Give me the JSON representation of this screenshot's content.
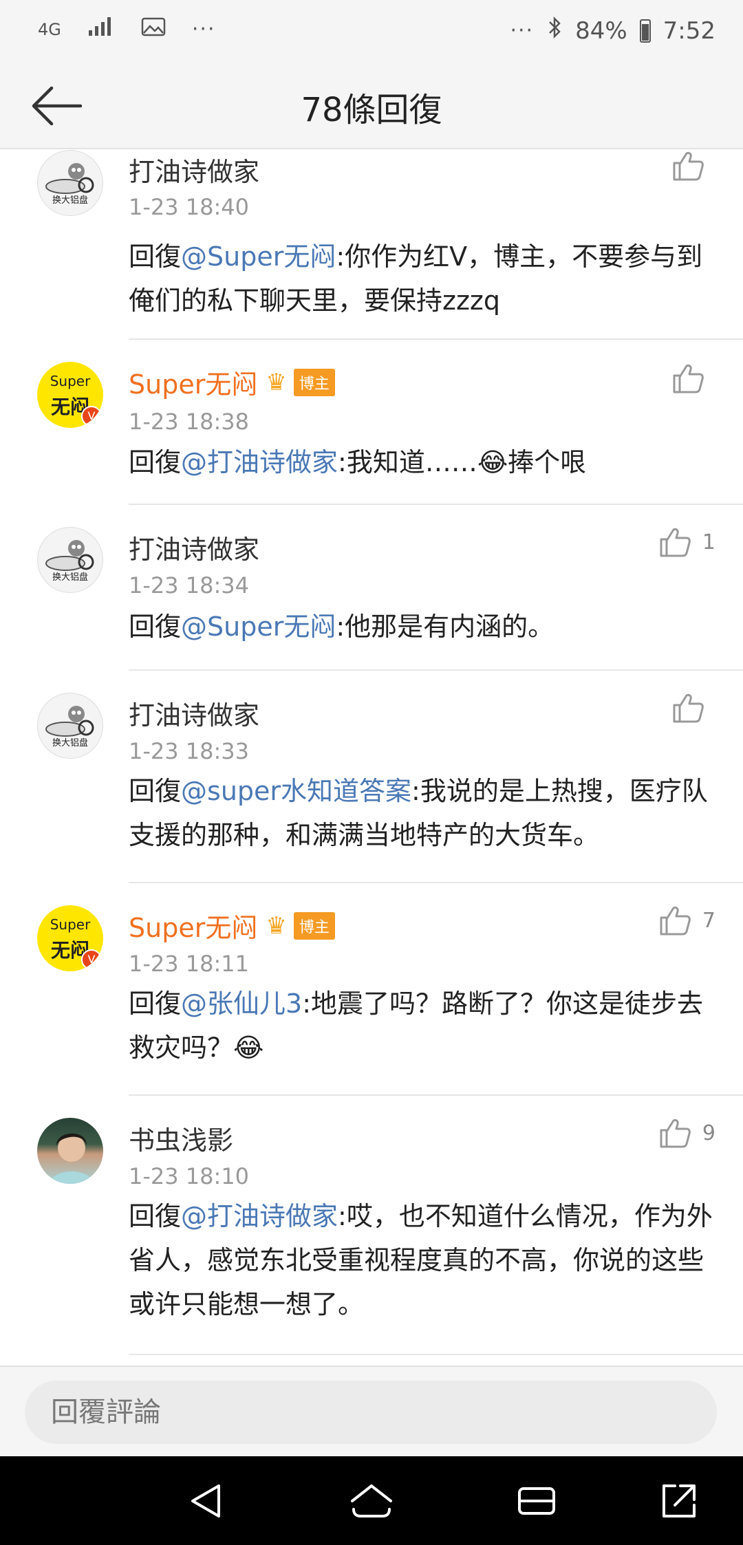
{
  "status_bar": {
    "network": "4G",
    "dots_left": "···",
    "dots_right": "···",
    "battery": "84%",
    "battery_level": 0.84,
    "time": "7:52"
  },
  "header": {
    "title": "78條回復"
  },
  "comments": [
    {
      "user": "打油诗做家",
      "avatar_text": "换大铝盘",
      "verified": false,
      "is_author": false,
      "time": "1-23 18:40",
      "reply_prefix": "回復",
      "mention": "@Super无闷",
      "text": ":你作为红V，博主，不要参与到俺们的私下聊天里，要保持zzzq",
      "likes": ""
    },
    {
      "user": "Super无闷",
      "avatar_text_top": "Super",
      "avatar_text_main": "无闷",
      "verified": true,
      "is_author": true,
      "author_badge": "博主",
      "time": "1-23 18:38",
      "reply_prefix": "回復",
      "mention": "@打油诗做家",
      "text": ":我知道……😂捧个哏",
      "likes": ""
    },
    {
      "user": "打油诗做家",
      "avatar_text": "换大铝盘",
      "verified": false,
      "is_author": false,
      "time": "1-23 18:34",
      "reply_prefix": "回復",
      "mention": "@Super无闷",
      "text": ":他那是有内涵的。",
      "likes": "1"
    },
    {
      "user": "打油诗做家",
      "avatar_text": "换大铝盘",
      "verified": false,
      "is_author": false,
      "time": "1-23 18:33",
      "reply_prefix": "回復",
      "mention": "@super水知道答案",
      "text": ":我说的是上热搜，医疗队支援的那种，和满满当地特产的大货车。",
      "likes": ""
    },
    {
      "user": "Super无闷",
      "avatar_text_top": "Super",
      "avatar_text_main": "无闷",
      "verified": true,
      "is_author": true,
      "author_badge": "博主",
      "time": "1-23 18:11",
      "reply_prefix": "回復",
      "mention": "@张仙儿3",
      "text": ":地震了吗？路断了？你这是徒步去救灾吗？😂",
      "likes": "7"
    },
    {
      "user": "书虫浅影",
      "verified": false,
      "is_author": false,
      "time": "1-23 18:10",
      "reply_prefix": "回復",
      "mention": "@打油诗做家",
      "text": ":哎，也不知道什么情况，作为外省人，感觉东北受重视程度真的不高，你说的这些或许只能想一想了。",
      "likes": "9"
    }
  ],
  "reply_bar": {
    "placeholder": "回覆評論"
  },
  "colors": {
    "mention": "#4a78b5",
    "author_name": "#f0701f",
    "badge": "#f59a23"
  }
}
